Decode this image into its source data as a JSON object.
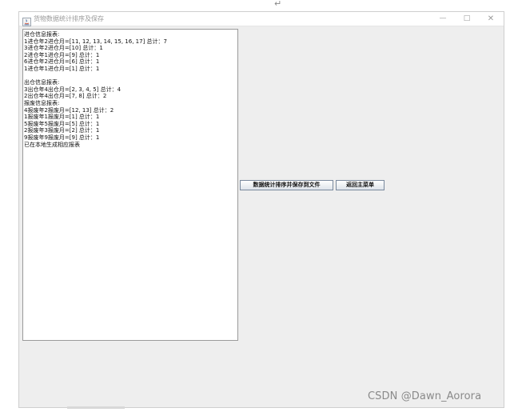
{
  "top_glyph": "↵",
  "window": {
    "title": "货物数据统计排序及保存",
    "controls": {
      "minimize": "—",
      "maximize": "□",
      "close": "✕"
    }
  },
  "report": {
    "lines": [
      "进仓信息报表:",
      "1进仓年2进仓月=[11, 12, 13, 14, 15, 16, 17] 总计：7",
      "3进仓年2进仓月=[10] 总计：1",
      "2进仓年1进仓月=[9] 总计：1",
      "6进仓年2进仓月=[6] 总计：1",
      "1进仓年1进仓月=[1] 总计：1",
      "",
      "出仓信息报表:",
      "3出仓年4出仓月=[2, 3, 4, 5] 总计：4",
      "2出仓年4出仓月=[7, 8] 总计：2",
      "报废信息报表:",
      "4报废年2报废月=[12, 13] 总计：2",
      "1报废年1报废月=[1] 总计：1",
      "5报废年5报废月=[5] 总计：1",
      "2报废年3报废月=[2] 总计：1",
      "9报废年9报废月=[9] 总计：1",
      "已在本地生成相应报表"
    ]
  },
  "buttons": {
    "save_label": "数据统计排序并保存到文件",
    "back_label": "返回主菜单"
  },
  "watermark": "CSDN @Dawn_Aorora"
}
